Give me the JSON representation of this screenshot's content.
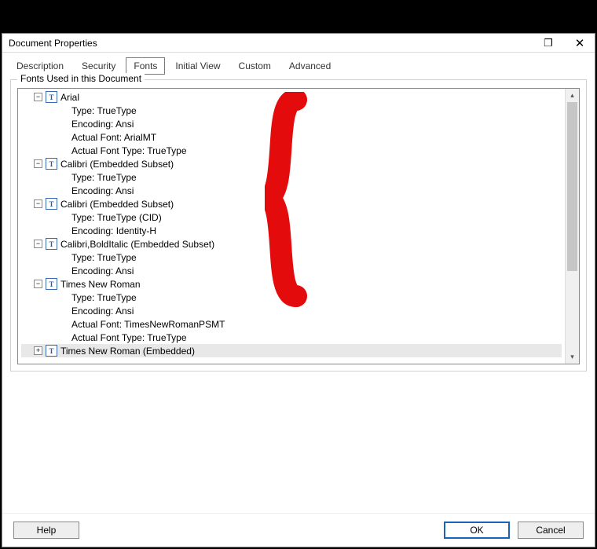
{
  "dialog": {
    "title": "Document Properties"
  },
  "tabs": {
    "description": "Description",
    "security": "Security",
    "fonts": "Fonts",
    "initial_view": "Initial View",
    "custom": "Custom",
    "advanced": "Advanced"
  },
  "group": {
    "label": "Fonts Used in this Document"
  },
  "fonts": [
    {
      "name": "Arial",
      "expanded": true,
      "details": [
        "Type: TrueType",
        "Encoding: Ansi",
        "Actual Font: ArialMT",
        "Actual Font Type: TrueType"
      ]
    },
    {
      "name": "Calibri (Embedded Subset)",
      "expanded": true,
      "details": [
        "Type: TrueType",
        "Encoding: Ansi"
      ]
    },
    {
      "name": "Calibri (Embedded Subset)",
      "expanded": true,
      "details": [
        "Type: TrueType (CID)",
        "Encoding: Identity-H"
      ]
    },
    {
      "name": "Calibri,BoldItalic (Embedded Subset)",
      "expanded": true,
      "details": [
        "Type: TrueType",
        "Encoding: Ansi"
      ]
    },
    {
      "name": "Times New Roman",
      "expanded": true,
      "details": [
        "Type: TrueType",
        "Encoding: Ansi",
        "Actual Font: TimesNewRomanPSMT",
        "Actual Font Type: TrueType"
      ]
    },
    {
      "name": "Times New Roman (Embedded)",
      "expanded": false,
      "selected": true,
      "details": []
    }
  ],
  "buttons": {
    "help": "Help",
    "ok": "OK",
    "cancel": "Cancel"
  },
  "icons": {
    "font_glyph": "T",
    "minus": "−",
    "plus": "+",
    "up": "▴",
    "down": "▾",
    "restore": "❐",
    "close": "✕"
  }
}
